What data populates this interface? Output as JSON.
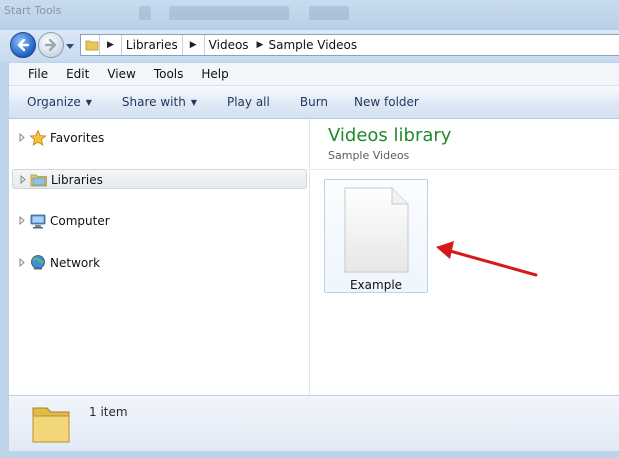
{
  "window": {
    "title": "Start Tools"
  },
  "breadcrumb": [
    "Libraries",
    "Videos",
    "Sample Videos"
  ],
  "menu": [
    "File",
    "Edit",
    "View",
    "Tools",
    "Help"
  ],
  "commands": {
    "organize": "Organize",
    "share_with": "Share with",
    "play_all": "Play all",
    "burn": "Burn",
    "new_folder": "New folder"
  },
  "nav": {
    "favorites": "Favorites",
    "libraries": "Libraries",
    "computer": "Computer",
    "network": "Network"
  },
  "library": {
    "title": "Videos library",
    "subtitle": "Sample Videos"
  },
  "files": [
    {
      "name": "Example",
      "icon": "blank-file-icon"
    }
  ],
  "status": {
    "item_count": "1 item"
  },
  "colors": {
    "library_title": "#1f8a2e",
    "annotation_arrow": "#d61a1a",
    "selection_border": "#b9d3ea"
  }
}
